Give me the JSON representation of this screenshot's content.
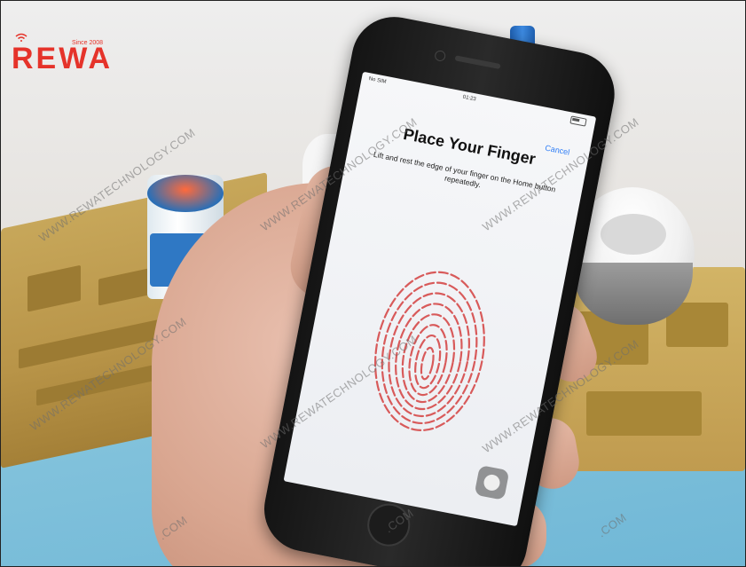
{
  "logo": {
    "brand": "REWA",
    "since": "Since 2008",
    "accent_color": "#e5332a"
  },
  "watermark": {
    "text": "WWW.REWATECHNOLOGY.COM",
    "partial": ".COM"
  },
  "phone": {
    "status_bar": {
      "carrier": "No SIM",
      "time": "01:23"
    },
    "cancel_label": "Cancel",
    "title": "Place Your Finger",
    "instructions": "Lift and rest the edge of your finger on the Home button repeatedly.",
    "fingerprint_icon": "fingerprint-icon",
    "assistive_touch_icon": "assistive-touch-icon",
    "link_color": "#2c7cf6"
  }
}
